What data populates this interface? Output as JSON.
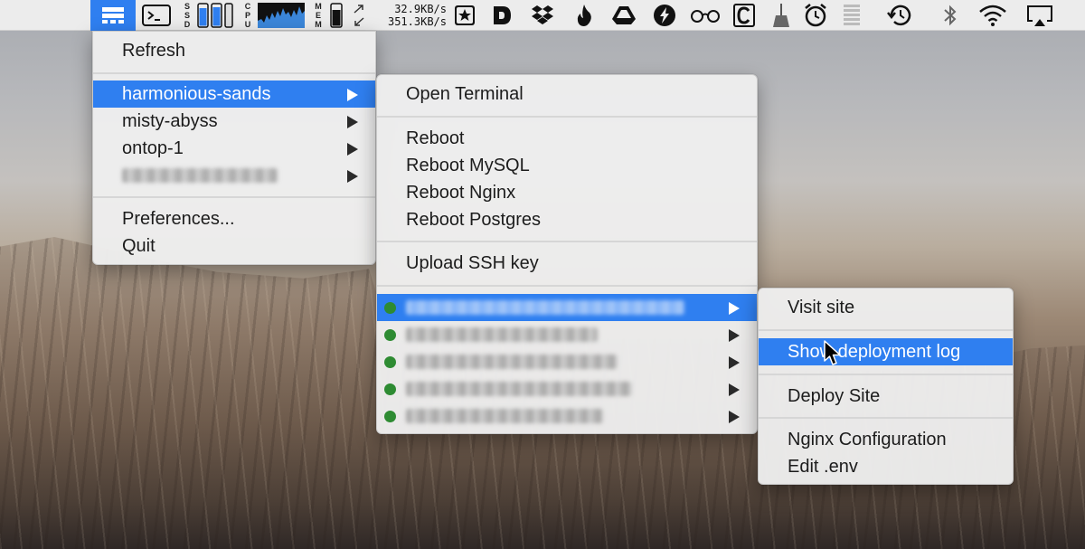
{
  "menubar": {
    "net_up": "32.9KB/s",
    "net_down": "351.3KB/s",
    "ssd_label": "SSD",
    "cpu_label": "CPU",
    "mem_label": "MEM",
    "icons": [
      "forge-app-icon",
      "terminal-icon",
      "ssd-usage-icon",
      "cpu-graph-icon",
      "memory-icon",
      "network-arrows-icon",
      "bookmark-star-icon",
      "dash-d-icon",
      "dropbox-icon",
      "flame-icon",
      "google-drive-icon",
      "lightning-icon",
      "glasses-icon",
      "copy-c-icon",
      "broom-icon",
      "alarm-clock-icon",
      "battery-bars-icon",
      "time-machine-icon",
      "bluetooth-icon",
      "wifi-icon",
      "airplay-icon"
    ]
  },
  "main_menu": {
    "refresh": "Refresh",
    "servers": [
      {
        "label": "harmonious-sands",
        "selected": true
      },
      {
        "label": "misty-abyss",
        "selected": false
      },
      {
        "label": "ontop-1",
        "selected": false
      },
      {
        "label": "",
        "redacted": true,
        "selected": false
      }
    ],
    "preferences": "Preferences...",
    "quit": "Quit"
  },
  "server_menu": {
    "open_terminal": "Open Terminal",
    "reboot": "Reboot",
    "reboot_mysql": "Reboot MySQL",
    "reboot_nginx": "Reboot Nginx",
    "reboot_postgres": "Reboot Postgres",
    "upload_ssh_key": "Upload SSH key",
    "sites_status_color": "#2e8b32",
    "sites": [
      {
        "label": "",
        "redacted": true,
        "selected": true,
        "status": "online"
      },
      {
        "label": "",
        "redacted": true,
        "selected": false,
        "status": "online"
      },
      {
        "label": "",
        "redacted": true,
        "selected": false,
        "status": "online"
      },
      {
        "label": "",
        "redacted": true,
        "selected": false,
        "status": "online"
      },
      {
        "label": "",
        "redacted": true,
        "selected": false,
        "status": "online"
      }
    ]
  },
  "site_menu": {
    "visit_site": "Visit site",
    "show_deployment_log": "Show deployment log",
    "deploy_site": "Deploy Site",
    "nginx_configuration": "Nginx Configuration",
    "edit_env": "Edit .env"
  },
  "colors": {
    "selection": "#2f7ff0",
    "menu_bg": "#eeeeee"
  }
}
